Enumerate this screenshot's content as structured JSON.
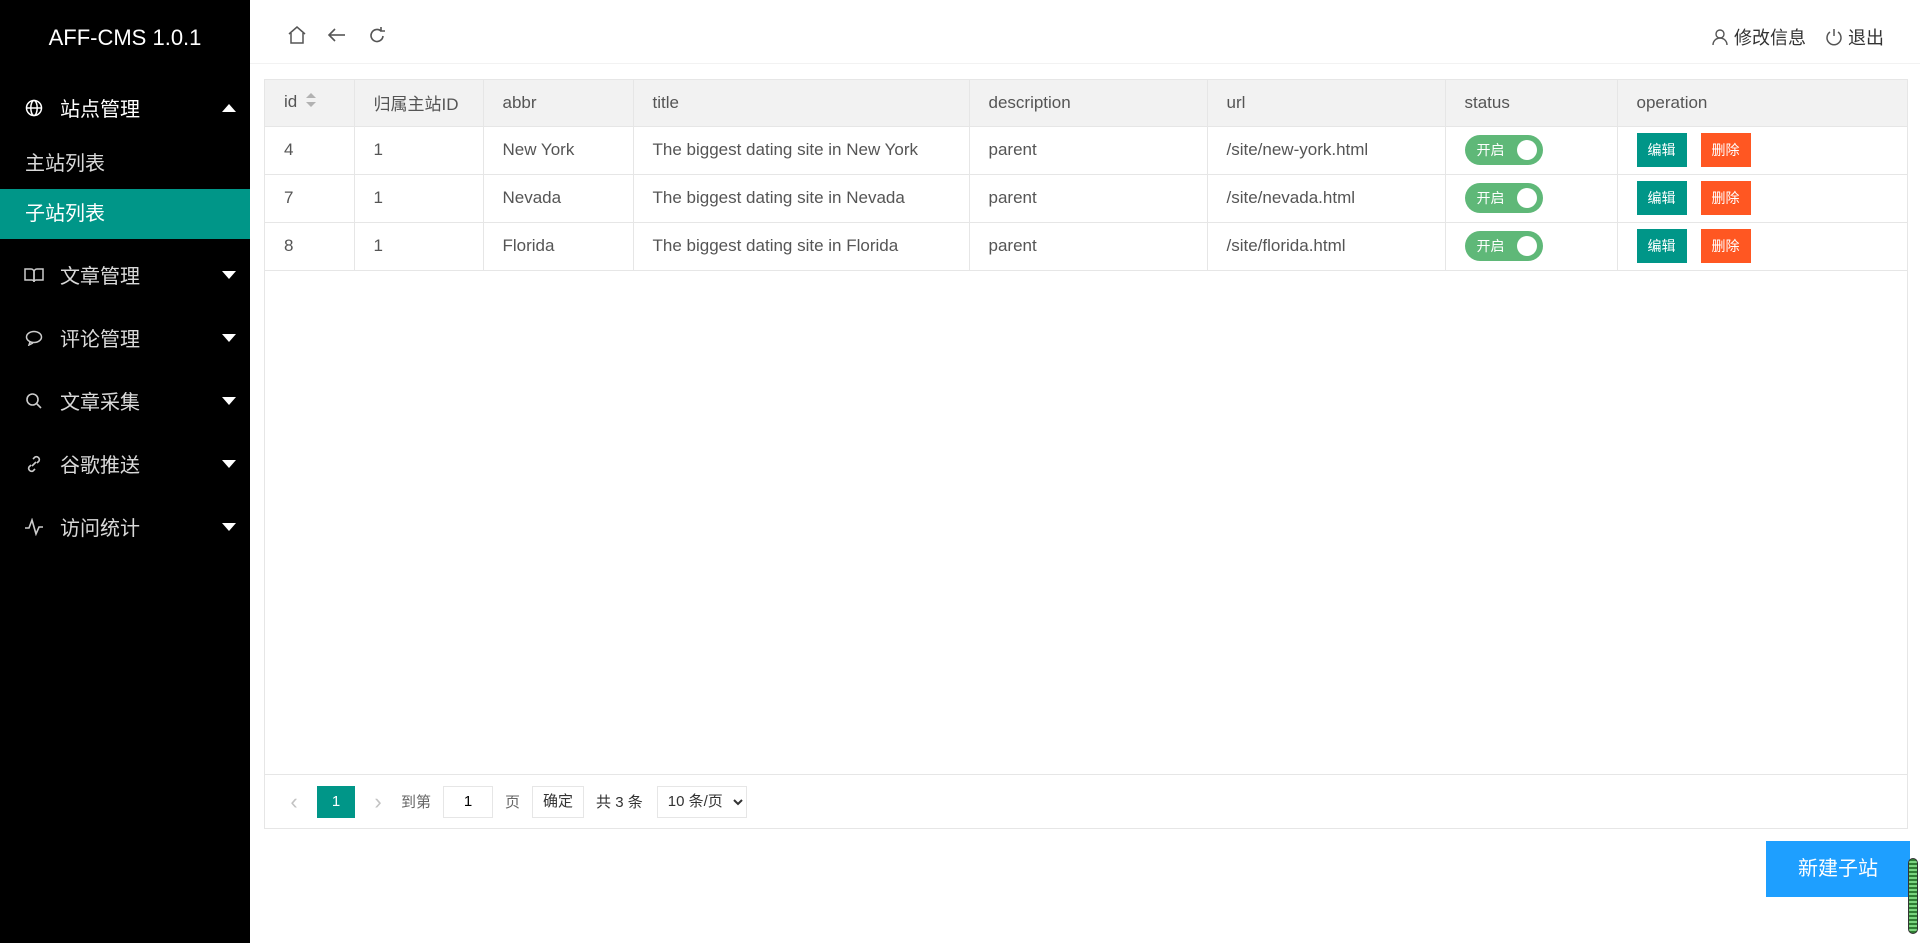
{
  "app": {
    "title": "AFF-CMS 1.0.1"
  },
  "sidebar": {
    "groups": [
      {
        "label": "站点管理",
        "icon": "globe-icon",
        "open": true,
        "items": [
          {
            "label": "主站列表"
          },
          {
            "label": "子站列表",
            "active": true
          }
        ]
      },
      {
        "label": "文章管理",
        "icon": "book-icon"
      },
      {
        "label": "评论管理",
        "icon": "comment-icon"
      },
      {
        "label": "文章采集",
        "icon": "search-icon"
      },
      {
        "label": "谷歌推送",
        "icon": "link-icon"
      },
      {
        "label": "访问统计",
        "icon": "pulse-icon"
      }
    ]
  },
  "header": {
    "icons": [
      "home-icon",
      "back-icon",
      "refresh-icon"
    ],
    "edit_profile": "修改信息",
    "logout": "退出"
  },
  "table": {
    "columns": [
      "id",
      "归属主站ID",
      "abbr",
      "title",
      "description",
      "url",
      "status",
      "operation"
    ],
    "rows": [
      {
        "id": "4",
        "parent_id": "1",
        "abbr": "New York",
        "title": "The biggest dating site in New York",
        "description": "parent",
        "url": "/site/new-york.html",
        "status": "开启"
      },
      {
        "id": "7",
        "parent_id": "1",
        "abbr": "Nevada",
        "title": "The biggest dating site in Nevada",
        "description": "parent",
        "url": "/site/nevada.html",
        "status": "开启"
      },
      {
        "id": "8",
        "parent_id": "1",
        "abbr": "Florida",
        "title": "The biggest dating site in Florida",
        "description": "parent",
        "url": "/site/florida.html",
        "status": "开启"
      }
    ],
    "edit_label": "编辑",
    "delete_label": "删除"
  },
  "pager": {
    "current": "1",
    "goto_label": "到第",
    "page_value": "1",
    "page_unit": "页",
    "confirm": "确定",
    "total": "共 3 条",
    "per_page": "10 条/页"
  },
  "actions": {
    "new_subsite": "新建子站"
  },
  "colors": {
    "sidebar_bg": "#000000",
    "accent": "#009688",
    "danger": "#ff5722",
    "switch_on": "#5fb878",
    "primary": "#1e9fff"
  }
}
